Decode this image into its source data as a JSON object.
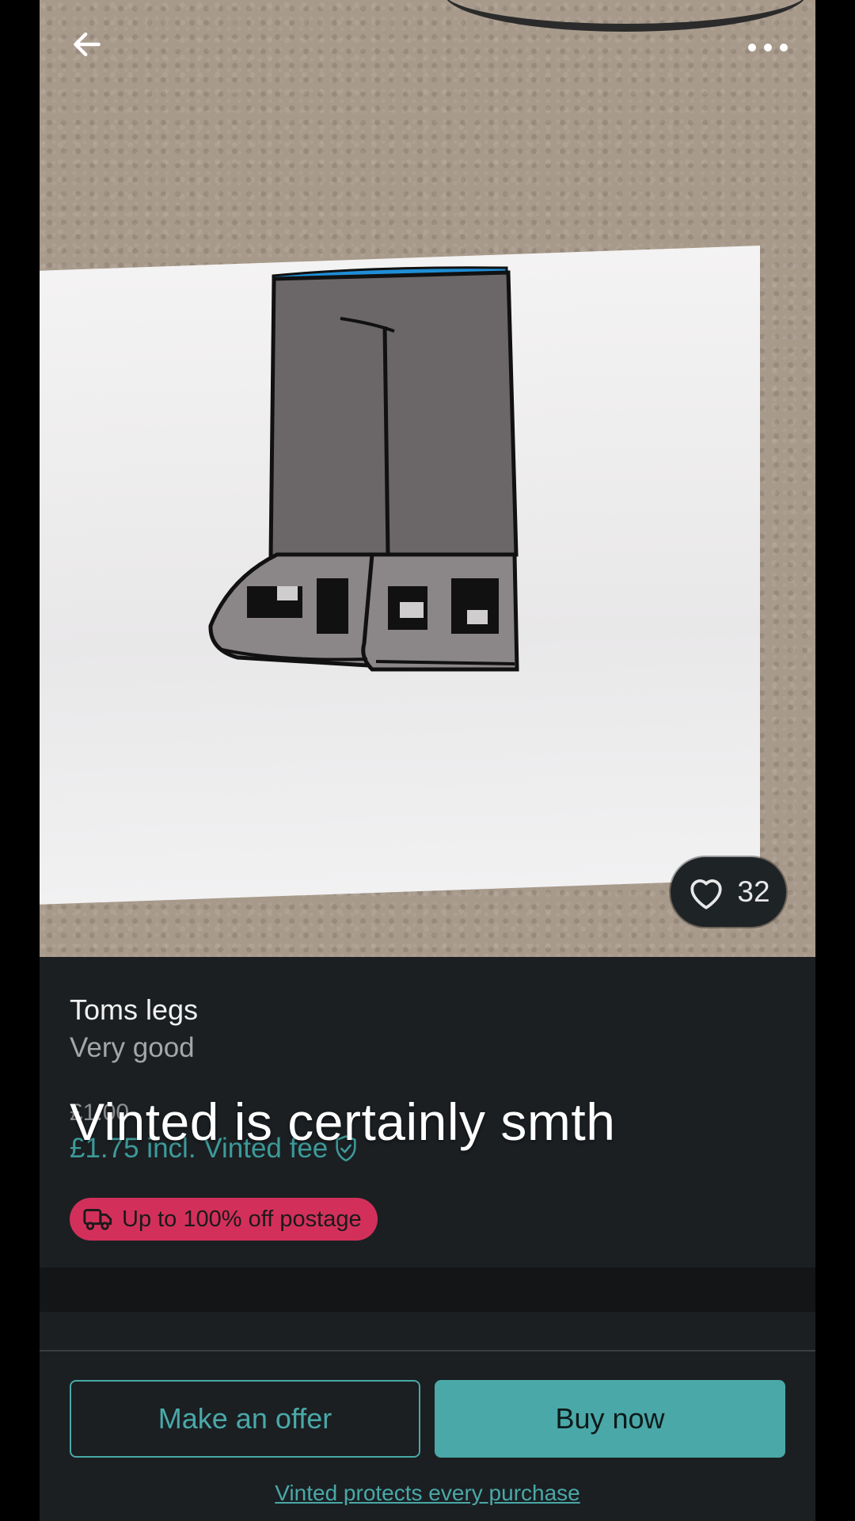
{
  "nav": {
    "back_icon": "arrow-left-icon",
    "more_icon": "more-horizontal-icon"
  },
  "favorites": {
    "icon": "heart-icon",
    "count": "32"
  },
  "item": {
    "title": "Toms legs",
    "condition": "Very good",
    "price": "£1.00",
    "price_incl_fee": "£1.75 incl. Vinted fee",
    "fee_icon": "shield-check-icon"
  },
  "overlay": {
    "caption": "Vinted is certainly smth"
  },
  "postage": {
    "icon": "truck-icon",
    "label": "Up to 100% off postage"
  },
  "actions": {
    "offer_label": "Make an offer",
    "buy_label": "Buy now",
    "protect_label": "Vinted protects every purchase"
  },
  "colors": {
    "accent": "#4aa8a8",
    "promo": "#d2305a",
    "background": "#1b1f22"
  }
}
